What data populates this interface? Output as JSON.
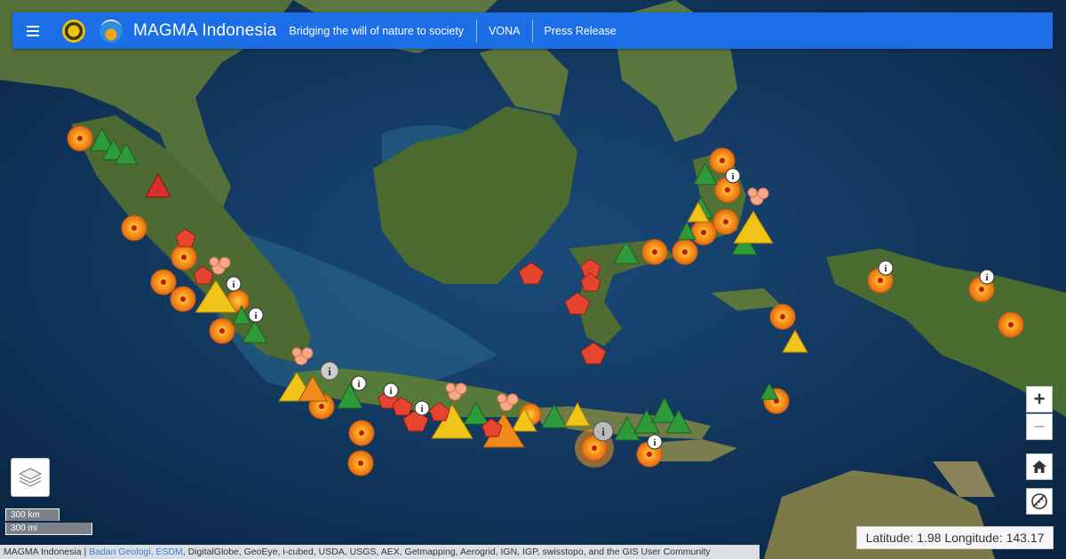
{
  "header": {
    "brand": "MAGMA Indonesia",
    "tagline": "Bridging the will of nature to society",
    "nav": [
      "VONA",
      "Press Release"
    ]
  },
  "colors": {
    "header_bg": "#1c6ee6",
    "ocean": "#143c6a",
    "land": "#4f6b34",
    "status_normal": "#2e9a3a",
    "status_waspada": "#f0c419",
    "status_siaga": "#f08a1c",
    "status_awas": "#d8302a"
  },
  "controls": {
    "zoom_in": "+",
    "zoom_out": "−",
    "home_icon": "home-icon",
    "measure_icon": "measure-icon",
    "layers_icon": "layers-icon"
  },
  "scale": {
    "km": "300 km",
    "mi": "300 mi"
  },
  "coordinates": {
    "latitude": "1.98",
    "longitude": "143.17",
    "text": "Latitude: 1.98 Longitude: 143.17"
  },
  "attribution": {
    "prefix": "MAGMA Indonesia | ",
    "links": "Badan Geologi, ESDM",
    "rest": ", DigitalGlobe, GeoEye, i-cubed, USDA, USGS, AEX, Getmapping, Aerogrid, IGN, IGP, swisstopo, and the GIS User Community"
  },
  "markers": {
    "triangle_green": "normal-volcano-icon",
    "triangle_yellow": "waspada-volcano-icon",
    "triangle_orange": "siaga-volcano-icon",
    "triangle_red": "awas-volcano-icon",
    "quake": "earthquake-icon",
    "info": "info-pin-icon",
    "eruption": "eruption-icon",
    "pentagon": "ground-movement-icon"
  }
}
